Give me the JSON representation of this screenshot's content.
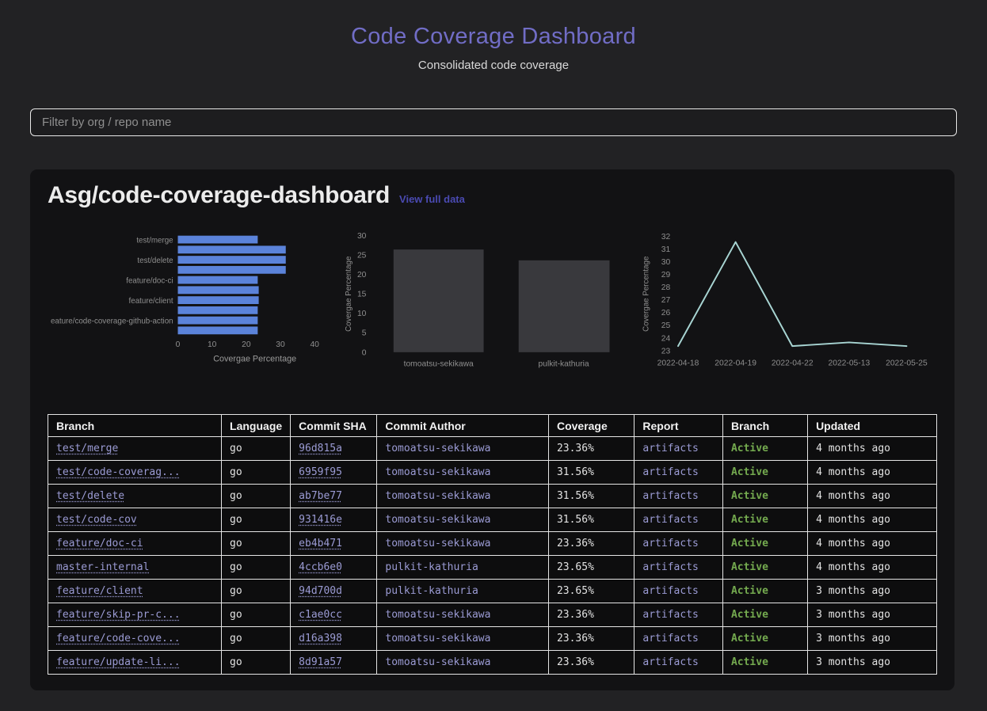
{
  "page": {
    "title": "Code Coverage Dashboard",
    "subtitle": "Consolidated code coverage"
  },
  "filter": {
    "placeholder": "Filter by org / repo name"
  },
  "repo_card": {
    "title": "Asg/code-coverage-dashboard",
    "link_label": "View full data"
  },
  "colors": {
    "accent_purple": "#716dc6",
    "view_link_purple": "#4a4ab2",
    "table_link_purple": "#9b9bd4",
    "bar_blue": "#5b83da",
    "bar_gray": "#39393d",
    "line_teal": "#a8d5d3",
    "active_green": "#74aa4f",
    "axis_text": "#8f8f8f",
    "axis_title": "#9b9b9b"
  },
  "chart_data": [
    {
      "type": "bar",
      "orientation": "horizontal",
      "xlabel": "Covergae Percentage",
      "categories": [
        "test/merge",
        "test/code-coverag...",
        "test/delete",
        "test/code-cov",
        "feature/doc-ci",
        "master-internal",
        "feature/client",
        "feature/skip-pr-c...",
        "feature/code-coverage-github-action",
        "feature/update-li..."
      ],
      "values": [
        23.36,
        31.56,
        31.56,
        31.56,
        23.36,
        23.65,
        23.65,
        23.36,
        23.36,
        23.36
      ],
      "shown_labels": [
        "test/merge",
        "test/delete",
        "feature/doc-ci",
        "feature/client",
        "eature/code-coverage-github-action"
      ],
      "shown_label_indices": [
        0,
        2,
        4,
        6,
        8
      ],
      "xlim": [
        0,
        45
      ],
      "xticks": [
        0,
        10,
        20,
        30,
        40
      ],
      "grid": false
    },
    {
      "type": "bar",
      "orientation": "vertical",
      "ylabel": "Covergae Percentage",
      "categories": [
        "tomoatsu-sekikawa",
        "pulkit-kathuria"
      ],
      "values": [
        26.44,
        23.65
      ],
      "ylim": [
        0,
        30
      ],
      "yticks": [
        0,
        5,
        10,
        15,
        20,
        25,
        30
      ],
      "grid": false
    },
    {
      "type": "line",
      "ylabel": "Covergae Percentage",
      "x": [
        "2022-04-18",
        "2022-04-19",
        "2022-04-22",
        "2022-05-13",
        "2022-05-25"
      ],
      "values": [
        23.36,
        31.56,
        23.36,
        23.65,
        23.36
      ],
      "ylim": [
        23,
        32
      ],
      "yticks": [
        23,
        24,
        25,
        26,
        27,
        28,
        29,
        30,
        31,
        32
      ],
      "grid": false
    }
  ],
  "table": {
    "headers": [
      "Branch",
      "Language",
      "Commit SHA",
      "Commit Author",
      "Coverage",
      "Report",
      "Branch",
      "Updated"
    ],
    "rows": [
      {
        "branch": "test/merge",
        "language": "go",
        "sha": "96d815a",
        "author": "tomoatsu-sekikawa",
        "coverage": "23.36%",
        "report": "artifacts",
        "status": "Active",
        "updated": "4 months ago"
      },
      {
        "branch": "test/code-coverag...",
        "language": "go",
        "sha": "6959f95",
        "author": "tomoatsu-sekikawa",
        "coverage": "31.56%",
        "report": "artifacts",
        "status": "Active",
        "updated": "4 months ago"
      },
      {
        "branch": "test/delete",
        "language": "go",
        "sha": "ab7be77",
        "author": "tomoatsu-sekikawa",
        "coverage": "31.56%",
        "report": "artifacts",
        "status": "Active",
        "updated": "4 months ago"
      },
      {
        "branch": "test/code-cov",
        "language": "go",
        "sha": "931416e",
        "author": "tomoatsu-sekikawa",
        "coverage": "31.56%",
        "report": "artifacts",
        "status": "Active",
        "updated": "4 months ago"
      },
      {
        "branch": "feature/doc-ci",
        "language": "go",
        "sha": "eb4b471",
        "author": "tomoatsu-sekikawa",
        "coverage": "23.36%",
        "report": "artifacts",
        "status": "Active",
        "updated": "4 months ago"
      },
      {
        "branch": "master-internal",
        "language": "go",
        "sha": "4ccb6e0",
        "author": "pulkit-kathuria",
        "coverage": "23.65%",
        "report": "artifacts",
        "status": "Active",
        "updated": "4 months ago"
      },
      {
        "branch": "feature/client",
        "language": "go",
        "sha": "94d700d",
        "author": "pulkit-kathuria",
        "coverage": "23.65%",
        "report": "artifacts",
        "status": "Active",
        "updated": "3 months ago"
      },
      {
        "branch": "feature/skip-pr-c...",
        "language": "go",
        "sha": "c1ae0cc",
        "author": "tomoatsu-sekikawa",
        "coverage": "23.36%",
        "report": "artifacts",
        "status": "Active",
        "updated": "3 months ago"
      },
      {
        "branch": "feature/code-cove...",
        "language": "go",
        "sha": "d16a398",
        "author": "tomoatsu-sekikawa",
        "coverage": "23.36%",
        "report": "artifacts",
        "status": "Active",
        "updated": "3 months ago"
      },
      {
        "branch": "feature/update-li...",
        "language": "go",
        "sha": "8d91a57",
        "author": "tomoatsu-sekikawa",
        "coverage": "23.36%",
        "report": "artifacts",
        "status": "Active",
        "updated": "3 months ago"
      }
    ]
  }
}
